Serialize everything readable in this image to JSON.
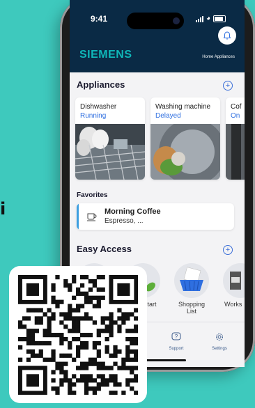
{
  "status": {
    "time": "9:41"
  },
  "header": {
    "logo": "SIEMENS",
    "subtitle": "Home Appliances"
  },
  "appliances": {
    "title": "Appliances",
    "cards": [
      {
        "name": "Dishwasher",
        "status": "Running"
      },
      {
        "name": "Washing machine",
        "status": "Delayed"
      },
      {
        "name": "Cof",
        "status": "On"
      }
    ]
  },
  "favorites": {
    "title": "Favorites",
    "item": {
      "title": "Morning Coffee",
      "subtitle": "Espresso, ..."
    }
  },
  "easy_access": {
    "title": "Easy Access",
    "items": [
      {
        "label": ""
      },
      {
        "label": "Start"
      },
      {
        "label": "Shopping List"
      },
      {
        "label": "Works"
      }
    ]
  },
  "nav": {
    "support": "Support",
    "settings": "Settings"
  },
  "left_text": "i",
  "colors": {
    "background": "#3ec9bd",
    "header": "#0a2a45",
    "accent": "#2f6fe0",
    "brand": "#0fb7b9"
  }
}
